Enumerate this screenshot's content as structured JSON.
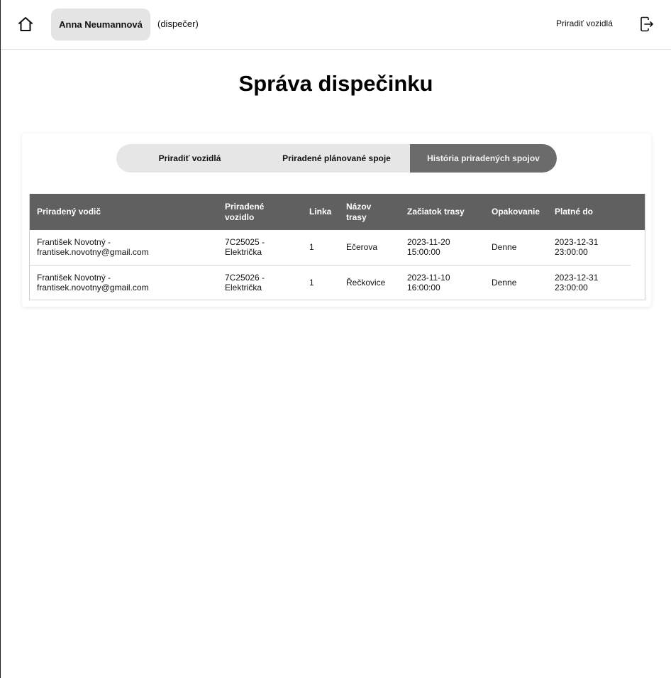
{
  "header": {
    "user_name": "Anna Neumannová",
    "role": "(dispečer)",
    "nav_link": "Priradiť vozidlá",
    "home_icon": "home-icon",
    "logout_icon": "logout-icon"
  },
  "page": {
    "title": "Správa dispečinku"
  },
  "tabs": [
    {
      "label": "Priradiť vozidlá",
      "active": false
    },
    {
      "label": "Priradené plánované spoje",
      "active": false
    },
    {
      "label": "História priradených spojov",
      "active": true
    }
  ],
  "table": {
    "headers": [
      "Priradený vodič",
      "Priradené vozidlo",
      "Linka",
      "Názov trasy",
      "Začiatok trasy",
      "Opakovanie",
      "Platné do"
    ],
    "rows": [
      {
        "driver_name": "František Novotný -",
        "driver_email": "frantisek.novotny@gmail.com",
        "vehicle_code": "7C25025 -",
        "vehicle_type": "Električka",
        "line": "1",
        "route": "Ečerova",
        "start_date": "2023-11-20",
        "start_time": "15:00:00",
        "repeat": "Denne",
        "valid_date": "2023-12-31",
        "valid_time": "23:00:00"
      },
      {
        "driver_name": "František Novotný -",
        "driver_email": "frantisek.novotny@gmail.com",
        "vehicle_code": "7C25026 -",
        "vehicle_type": "Električka",
        "line": "1",
        "route": "Řečkovice",
        "start_date": "2023-11-10",
        "start_time": "16:00:00",
        "repeat": "Denne",
        "valid_date": "2023-12-31",
        "valid_time": "23:00:00"
      }
    ]
  },
  "colors": {
    "table_header_bg": "#606060",
    "active_tab_bg": "#6b6b6b",
    "tab_bar_bg": "#e6e6e6",
    "user_chip_bg": "#e4e4e4"
  }
}
